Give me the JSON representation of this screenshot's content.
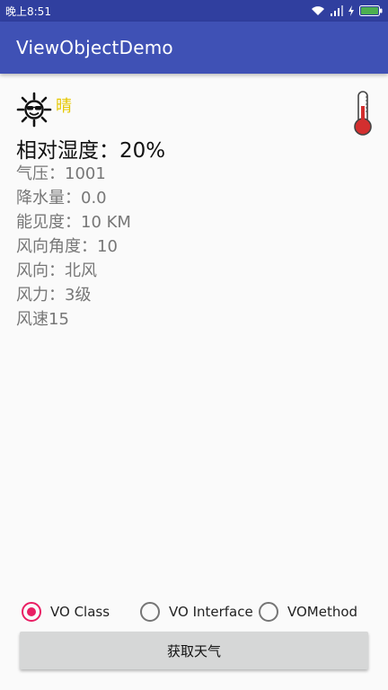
{
  "status_bar": {
    "time": "晚上8:51",
    "icons": [
      "wifi-icon",
      "signal-icon",
      "charging-icon",
      "battery-icon"
    ],
    "battery_color": "#4caf50"
  },
  "toolbar": {
    "title": "ViewObjectDemo",
    "color": "#3f51b5"
  },
  "weather": {
    "icon": "sun-sunglasses-icon",
    "state": "晴",
    "state_color": "#e6c800",
    "humidity": "相对湿度：20%",
    "details": [
      "气压：1001",
      "降水量：0.0",
      "能见度：10 KM",
      "风向角度：10",
      "风向：北风",
      "风力：3级",
      "风速15"
    ],
    "thermometer_icon": "thermometer-icon"
  },
  "options": {
    "accent_color": "#e91e63",
    "items": [
      {
        "label": "VO Class",
        "checked": true
      },
      {
        "label": "VO Interface",
        "checked": false
      },
      {
        "label": "VOMethod",
        "checked": false
      }
    ]
  },
  "actions": {
    "fetch_label": "获取天气"
  }
}
